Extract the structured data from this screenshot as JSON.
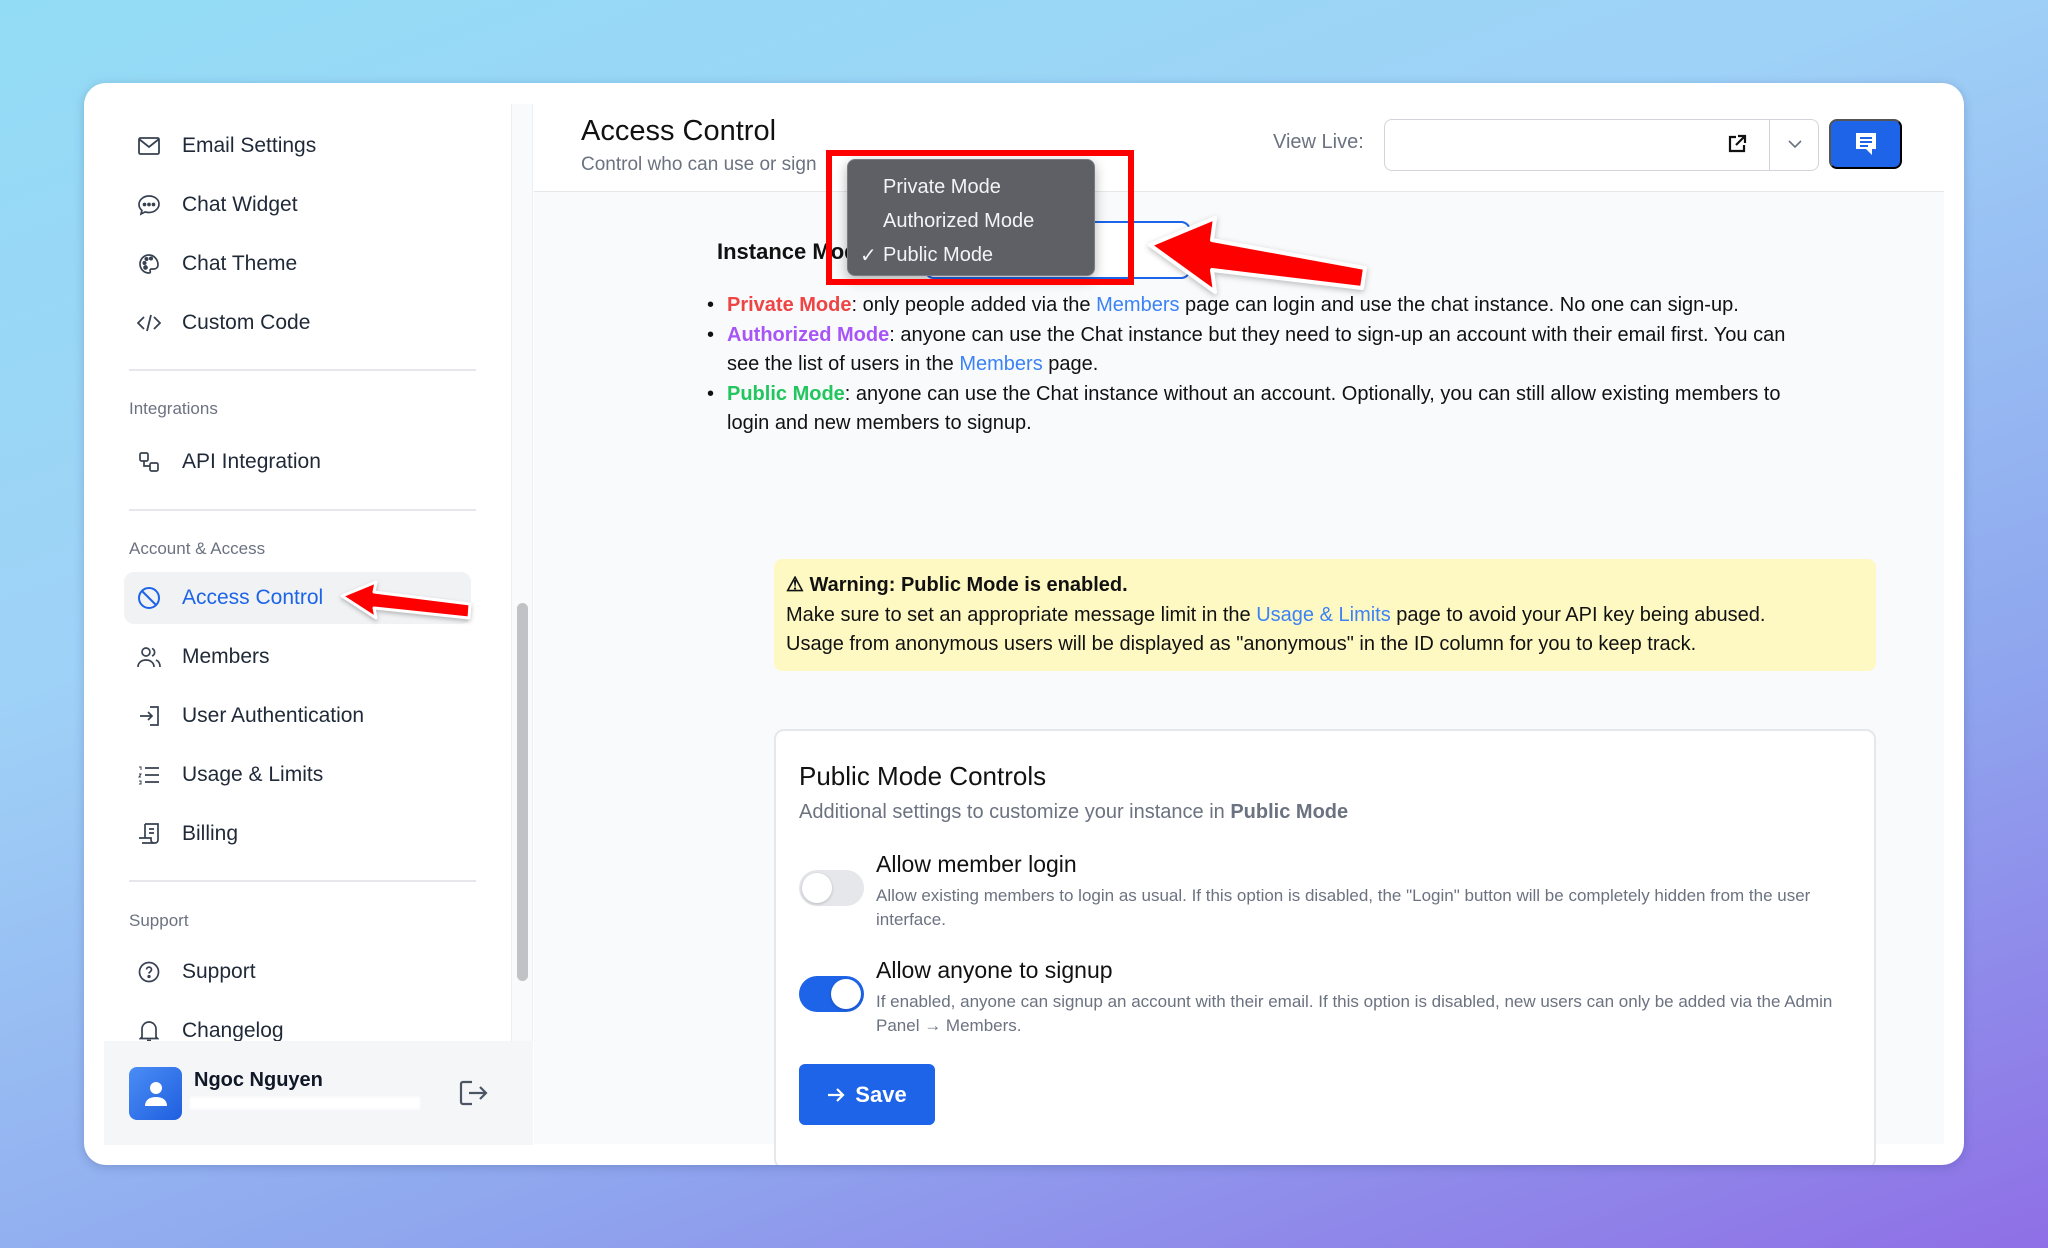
{
  "sidebar": {
    "items_top": [
      {
        "label": "Email Settings",
        "icon": "mail-icon"
      },
      {
        "label": "Chat Widget",
        "icon": "chat-bubble-icon"
      },
      {
        "label": "Chat Theme",
        "icon": "palette-icon"
      },
      {
        "label": "Custom Code",
        "icon": "code-icon"
      }
    ],
    "sections": [
      {
        "label": "Integrations",
        "items": [
          {
            "label": "API Integration",
            "icon": "api-icon"
          }
        ]
      },
      {
        "label": "Account & Access",
        "items": [
          {
            "label": "Access Control",
            "icon": "ban-icon",
            "active": true
          },
          {
            "label": "Members",
            "icon": "users-icon"
          },
          {
            "label": "User Authentication",
            "icon": "login-icon"
          },
          {
            "label": "Usage & Limits",
            "icon": "list-ordered-icon"
          },
          {
            "label": "Billing",
            "icon": "receipt-icon"
          }
        ]
      },
      {
        "label": "Support",
        "items": [
          {
            "label": "Support",
            "icon": "help-circle-icon"
          },
          {
            "label": "Changelog",
            "icon": "bell-icon"
          }
        ]
      }
    ],
    "user": {
      "name": "Ngoc Nguyen",
      "email": ""
    }
  },
  "header": {
    "title": "Access Control",
    "subtitle": "Control who can use or sign",
    "view_live_label": "View Live:",
    "view_live_value": ""
  },
  "instance_mode": {
    "label": "Instance Mode:",
    "selected": "Public Mode",
    "options": [
      "Private Mode",
      "Authorized Mode",
      "Public Mode"
    ]
  },
  "modes": {
    "private": {
      "name": "Private Mode",
      "text1": ": only people added via the ",
      "link": "Members",
      "text2": " page can login and use the chat instance. No one can sign-up."
    },
    "authorized": {
      "name": "Authorized Mode",
      "text1": ": anyone can use the Chat instance but they need to sign-up an account with their email first. You can see the list of users in the ",
      "link": "Members",
      "text2": " page."
    },
    "public": {
      "name": "Public Mode",
      "text1": ": anyone can use the Chat instance without an account. Optionally, you can still allow existing members to login and new members to signup."
    }
  },
  "warning": {
    "title": "⚠ Warning: Public Mode is enabled.",
    "text1": "Make sure to set an appropriate message limit in the ",
    "link": "Usage & Limits",
    "text2": " page to avoid your API key being abused.",
    "text3": "Usage from anonymous users will be displayed as \"anonymous\" in the ID column for you to keep track."
  },
  "public_controls": {
    "title": "Public Mode Controls",
    "subtitle_prefix": "Additional settings to customize your instance in ",
    "subtitle_bold": "Public Mode",
    "options": [
      {
        "title": "Allow member login",
        "desc": "Allow existing members to login as usual. If this option is disabled, the \"Login\" button will be completely hidden from the user interface.",
        "enabled": false
      },
      {
        "title": "Allow anyone to signup",
        "desc": "If enabled, anyone can signup an account with their email. If this option is disabled, new users can only be added via the Admin Panel → Members.",
        "enabled": true
      }
    ],
    "save_label": "Save"
  },
  "colors": {
    "accent": "#1d64e8",
    "private": "#ef4444",
    "authorized": "#a855f7",
    "public": "#22c55e",
    "link": "#3b82f6",
    "warning_bg": "#fef9c3",
    "annotation": "#ff0000"
  }
}
